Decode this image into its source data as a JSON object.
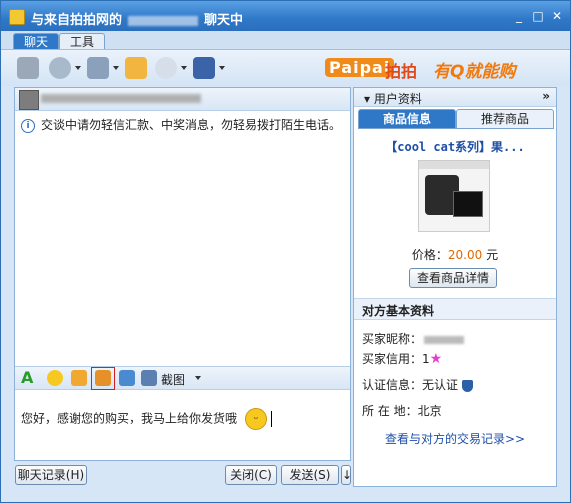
{
  "window": {
    "title_prefix": "与来自拍拍网的",
    "title_suffix": "聊天中"
  },
  "tabs": [
    {
      "label": "聊天"
    },
    {
      "label": "工具"
    }
  ],
  "brand": {
    "pai": "Paipai",
    "paipai": "拍拍",
    "slogan": "有Q就能购"
  },
  "chat": {
    "notice": "交谈中请勿轻信汇款、中奖消息，勿轻易拨打陌生电话。",
    "screenshot_label": "截图",
    "input_text": "您好，感谢您的购买，我马上给你发货哦"
  },
  "bottom": {
    "history": "聊天记录(H)",
    "close": "关闭(C)",
    "send": "发送(S)"
  },
  "panel": {
    "header": "用户资料",
    "tab_product": "商品信息",
    "tab_recommend": "推荐商品",
    "product_title": "【cool cat系列】果...",
    "price_label": "价格：",
    "price_value": "20.00",
    "price_unit": "元",
    "detail_button": "查看商品详情",
    "section_title": "对方基本资料",
    "nickname_label": "买家昵称：",
    "credit_label": "买家信用：",
    "credit_value": "1",
    "auth_label": "认证信息：",
    "auth_value": "无认证",
    "location_label": "所 在 地：",
    "location_value": "北京",
    "trade_link": "查看与对方的交易记录>>"
  }
}
